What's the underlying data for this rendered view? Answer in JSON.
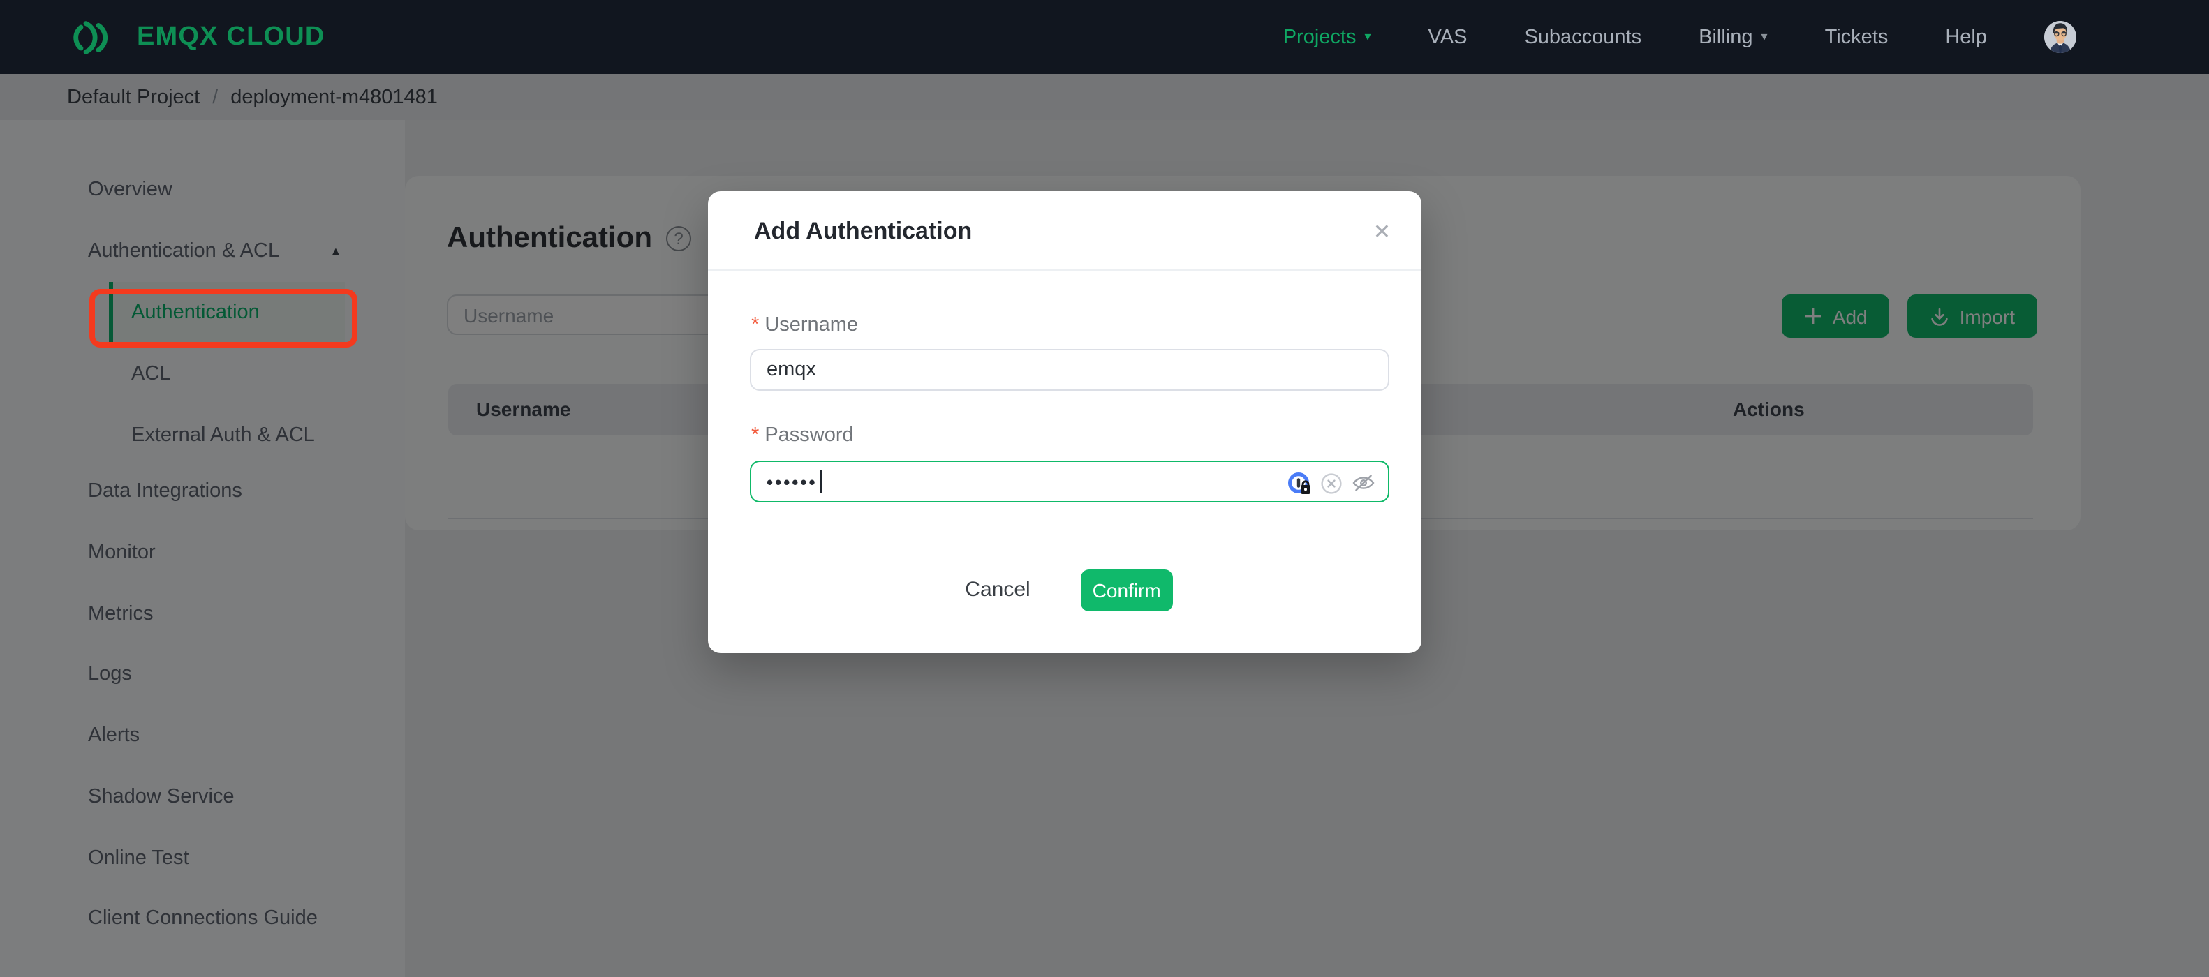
{
  "navbar": {
    "brand": "EMQX CLOUD",
    "items": [
      {
        "label": "Projects",
        "caret": true,
        "active": true
      },
      {
        "label": "VAS"
      },
      {
        "label": "Subaccounts"
      },
      {
        "label": "Billing",
        "caret": true
      },
      {
        "label": "Tickets"
      },
      {
        "label": "Help"
      }
    ]
  },
  "breadcrumb": {
    "project": "Default Project",
    "separator": "/",
    "deployment": "deployment-m4801481"
  },
  "sidebar": {
    "items": [
      {
        "label": "Overview"
      },
      {
        "label": "Authentication & ACL",
        "expanded": true
      },
      {
        "label": "Authentication",
        "child": true,
        "active": true
      },
      {
        "label": "ACL",
        "child": true
      },
      {
        "label": "External Auth & ACL",
        "child": true
      },
      {
        "label": "Data Integrations"
      },
      {
        "label": "Monitor"
      },
      {
        "label": "Metrics"
      },
      {
        "label": "Logs"
      },
      {
        "label": "Alerts"
      },
      {
        "label": "Shadow Service"
      },
      {
        "label": "Online Test"
      },
      {
        "label": "Client Connections Guide"
      }
    ]
  },
  "page": {
    "title": "Authentication",
    "search_placeholder": "Username",
    "add_label": "Add",
    "import_label": "Import",
    "table": {
      "col_username": "Username",
      "col_actions": "Actions"
    }
  },
  "modal": {
    "title": "Add Authentication",
    "username_label": "Username",
    "username_value": "emqx",
    "password_label": "Password",
    "password_masked_value": "••••••",
    "cancel_label": "Cancel",
    "confirm_label": "Confirm",
    "required_marker": "*"
  },
  "icons": {
    "caret_down": "▾",
    "caret_up": "▲",
    "plus": "+",
    "close": "✕",
    "question": "?"
  },
  "colors": {
    "accent_green": "#10b96b",
    "brand_green": "#0e8f54",
    "annotation_red": "#f43a1e",
    "navbar_bg": "#11161f",
    "overlay": "rgba(0,0,0,0.5)"
  }
}
